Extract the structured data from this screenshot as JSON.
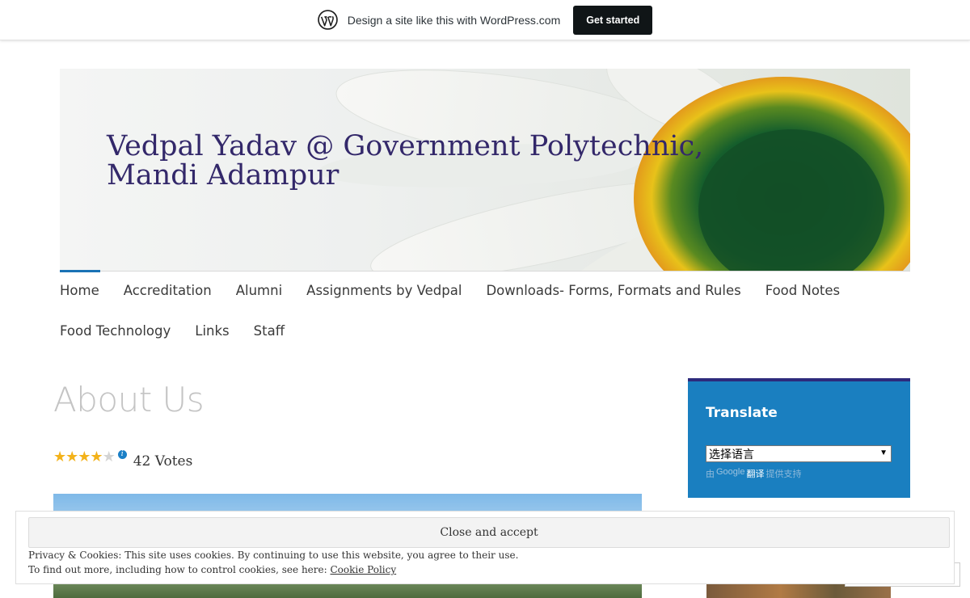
{
  "wpbar": {
    "logo_icon": "wordpress-logo-icon",
    "text": "Design a site like this with WordPress.com",
    "button": "Get started"
  },
  "header": {
    "site_title": "Vedpal Yadav @ Government Polytechnic, Mandi Adampur",
    "title_color": "#33286a"
  },
  "nav": {
    "accent": "#1a72b5",
    "row1": [
      "Home",
      "Accreditation",
      "Alumni",
      "Assignments by Vedpal",
      "Downloads- Forms, Formats and Rules",
      "Food Notes"
    ],
    "row2": [
      "Food Technology",
      "Links",
      "Staff"
    ],
    "active": "Home"
  },
  "page": {
    "title": "About Us",
    "rating": {
      "stars_filled": 4,
      "stars_total": 5,
      "votes_label": "42 Votes"
    }
  },
  "sidebar": {
    "translate": {
      "title": "Translate",
      "select_value": "选择语言",
      "powered_by": "由",
      "google": "Google",
      "translate_link": "翻译",
      "powered_suffix": "提供支持",
      "bg": "#1a7fc0"
    }
  },
  "cookie": {
    "button": "Close and accept",
    "line1": "Privacy & Cookies: This site uses cookies. By continuing to use this website, you agree to their use.",
    "line2_prefix": "To find out more, including how to control cookies, see here:",
    "line2_link": "Cookie Policy"
  }
}
